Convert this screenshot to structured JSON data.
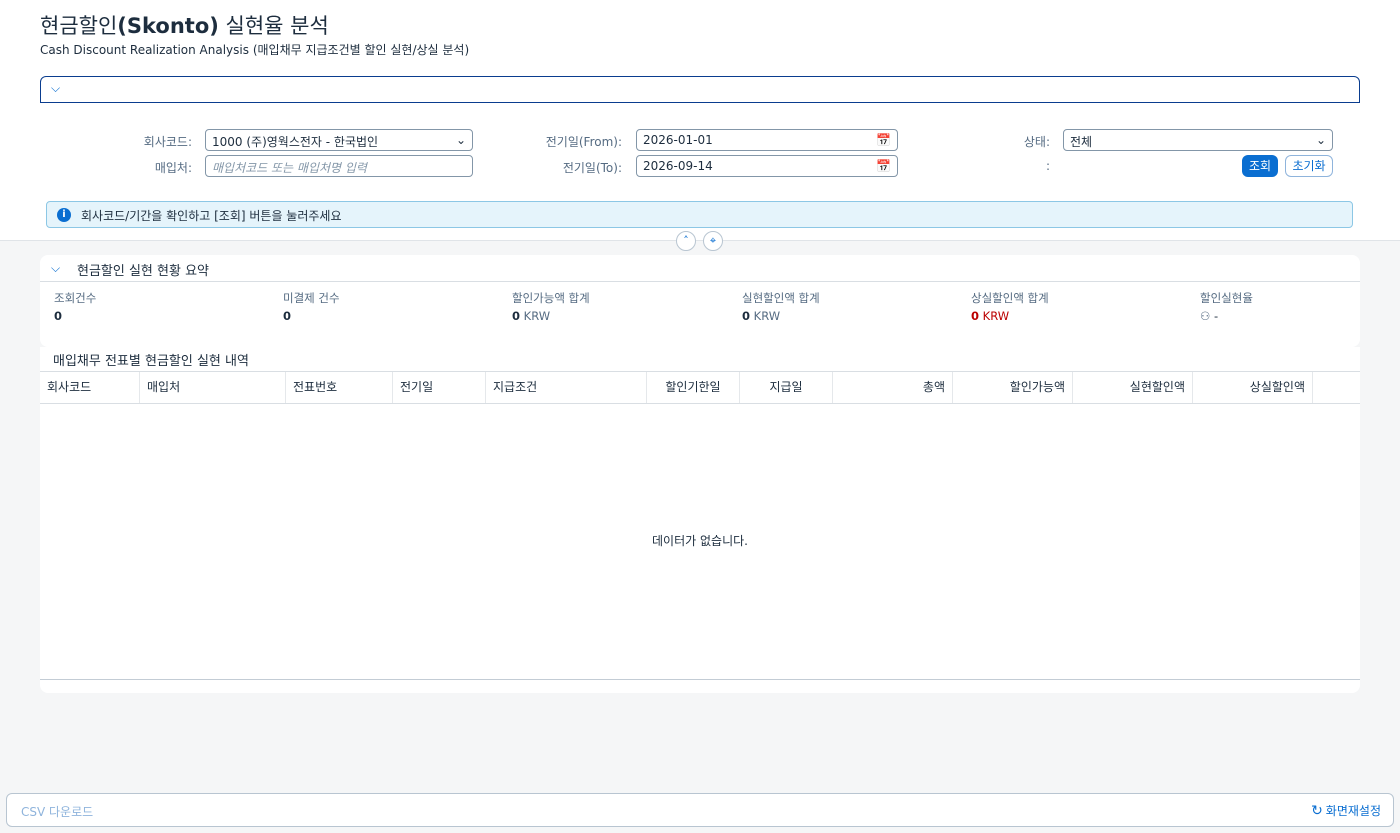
{
  "header": {
    "title_main": "현금할인",
    "title_bold": "(Skonto)",
    "title_rest": " 실현율 분석",
    "subtitle": "Cash Discount Realization Analysis (매입채무 지급조건별 할인 실현/상실 분석)"
  },
  "filters": {
    "company_label": "회사코드:",
    "company_value": "1000 (주)영웍스전자 - 한국법인",
    "vendor_label": "매입처:",
    "vendor_placeholder": "매입처코드 또는 매입처명 입력",
    "from_label": "전기일(From):",
    "from_value": "2026-01-01",
    "to_label": "전기일(To):",
    "to_value": "2026-09-14",
    "status_label": "상태:",
    "status_value": "전체",
    "colon_label": ":",
    "search_button": "조회",
    "reset_button": "초기화"
  },
  "info_message": "회사코드/기간을 확인하고 [조회] 버튼을 눌러주세요",
  "summary": {
    "title": "현금할인 실현 현황 요약",
    "kpis": [
      {
        "label": "조회건수",
        "value": "0",
        "unit": ""
      },
      {
        "label": "미결제 건수",
        "value": "0",
        "unit": ""
      },
      {
        "label": "할인가능액 합계",
        "value": "0",
        "unit": "KRW"
      },
      {
        "label": "실현할인액 합계",
        "value": "0",
        "unit": "KRW"
      },
      {
        "label": "상실할인액 합계",
        "value": "0",
        "unit": "KRW"
      },
      {
        "label": "할인실현율",
        "value": "-",
        "unit": ""
      }
    ]
  },
  "table": {
    "title": "매입채무 전표별 현금할인 실현 내역",
    "columns": [
      "회사코드",
      "매입처",
      "전표번호",
      "전기일",
      "지급조건",
      "할인기한일",
      "지급일",
      "총액",
      "할인가능액",
      "실현할인액",
      "상실할인액"
    ],
    "empty_text": "데이터가 없습니다."
  },
  "footer": {
    "csv_button": "CSV 다운로드",
    "reset_layout_button": "화면재설정"
  },
  "colors": {
    "accent": "#0a6ed1",
    "negative": "#bb0000"
  }
}
